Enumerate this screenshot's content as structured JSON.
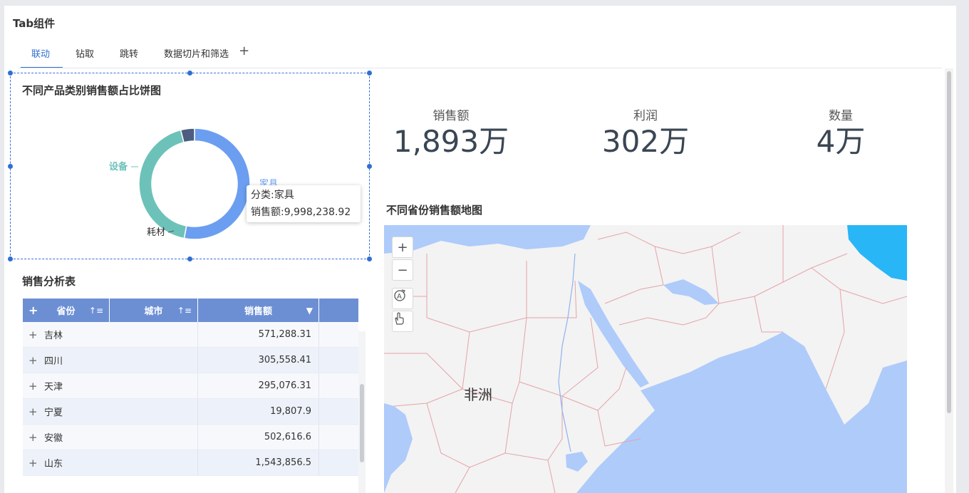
{
  "app": {
    "title": "Tab组件"
  },
  "tabs": [
    {
      "label": "联动",
      "active": true
    },
    {
      "label": "钻取",
      "active": false
    },
    {
      "label": "跳转",
      "active": false
    },
    {
      "label": "数据切片和筛选",
      "active": false
    }
  ],
  "tab_add_icon": "plus-icon",
  "pie": {
    "title": "不同产品类别销售额占比饼图",
    "labels": [
      "设备",
      "家具",
      "耗材"
    ],
    "colors": {
      "家具": "#6b9ef0",
      "设备": "#6cc2b8",
      "耗材": "#4c5d80"
    },
    "tooltip": {
      "line1": "分类:家具",
      "line2": "销售额:9,998,238.92"
    }
  },
  "chart_data": {
    "type": "pie",
    "title": "不同产品类别销售额占比饼图",
    "categories": [
      "家具",
      "设备",
      "耗材"
    ],
    "values": [
      0.53,
      0.43,
      0.04
    ],
    "tooltip_value": {
      "category": "家具",
      "销售额": 9998238.92
    }
  },
  "kpis": [
    {
      "label": "销售额",
      "value": "1,893万"
    },
    {
      "label": "利润",
      "value": "302万"
    },
    {
      "label": "数量",
      "value": "4万"
    }
  ],
  "table": {
    "title": "销售分析表",
    "columns": [
      "省份",
      "城市",
      "销售额"
    ],
    "rows": [
      {
        "province": "吉林",
        "sales": "571,288.31"
      },
      {
        "province": "四川",
        "sales": "305,558.41"
      },
      {
        "province": "天津",
        "sales": "295,076.31"
      },
      {
        "province": "宁夏",
        "sales": "19,807.9"
      },
      {
        "province": "安徽",
        "sales": "502,616.6"
      },
      {
        "province": "山东",
        "sales": "1,543,856.5"
      }
    ]
  },
  "map": {
    "title": "不同省份销售额地图",
    "region_label": "非洲",
    "controls": [
      "zoom-in-icon",
      "zoom-out-icon",
      "reset-icon",
      "pan-icon"
    ],
    "control_symbols": {
      "zoom_in": "+",
      "zoom_out": "−"
    },
    "highlight_color": "#29b6f6",
    "water_color": "#aecbfa",
    "land_color": "#f3f3f3"
  }
}
